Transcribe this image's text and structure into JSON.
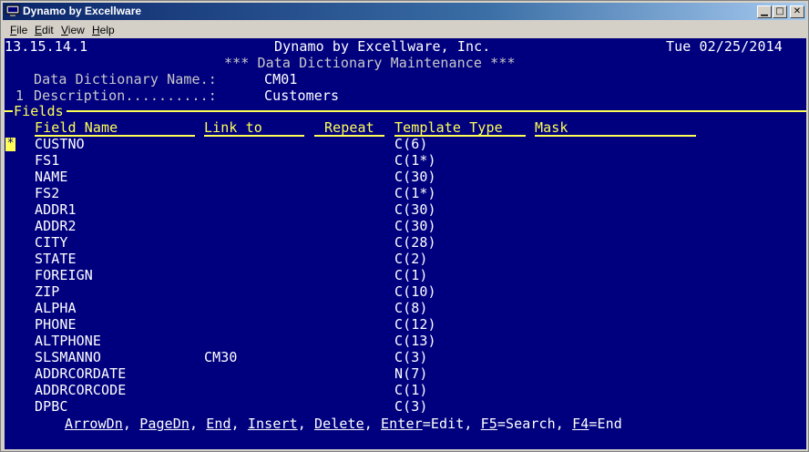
{
  "window": {
    "title": "Dynamo by Excellware"
  },
  "menu": [
    "File",
    "Edit",
    "View",
    "Help"
  ],
  "header": {
    "version": "13.15.14.1",
    "company": "Dynamo by Excellware, Inc.",
    "date": "Tue 02/25/2014",
    "screen_title": "*** Data Dictionary Maintenance ***",
    "dd_name_label": "Data Dictionary Name.:",
    "dd_name_value": "CM01",
    "desc_index": "1",
    "desc_label": "Description..........:",
    "desc_value": "Customers"
  },
  "section_label": "Fields",
  "columns": [
    "Field Name",
    "Link to",
    "Repeat",
    "Template Type",
    "Mask"
  ],
  "rows": [
    {
      "name": "CUSTNO",
      "link": "",
      "repeat": "",
      "template": "C(6)",
      "mask": ""
    },
    {
      "name": "FS1",
      "link": "",
      "repeat": "",
      "template": "C(1*)",
      "mask": ""
    },
    {
      "name": "NAME",
      "link": "",
      "repeat": "",
      "template": "C(30)",
      "mask": ""
    },
    {
      "name": "FS2",
      "link": "",
      "repeat": "",
      "template": "C(1*)",
      "mask": ""
    },
    {
      "name": "ADDR1",
      "link": "",
      "repeat": "",
      "template": "C(30)",
      "mask": ""
    },
    {
      "name": "ADDR2",
      "link": "",
      "repeat": "",
      "template": "C(30)",
      "mask": ""
    },
    {
      "name": "CITY",
      "link": "",
      "repeat": "",
      "template": "C(28)",
      "mask": ""
    },
    {
      "name": "STATE",
      "link": "",
      "repeat": "",
      "template": "C(2)",
      "mask": ""
    },
    {
      "name": "FOREIGN",
      "link": "",
      "repeat": "",
      "template": "C(1)",
      "mask": ""
    },
    {
      "name": "ZIP",
      "link": "",
      "repeat": "",
      "template": "C(10)",
      "mask": ""
    },
    {
      "name": "ALPHA",
      "link": "",
      "repeat": "",
      "template": "C(8)",
      "mask": ""
    },
    {
      "name": "PHONE",
      "link": "",
      "repeat": "",
      "template": "C(12)",
      "mask": ""
    },
    {
      "name": "ALTPHONE",
      "link": "",
      "repeat": "",
      "template": "C(13)",
      "mask": ""
    },
    {
      "name": "SLSMANNO",
      "link": "CM30",
      "repeat": "",
      "template": "C(3)",
      "mask": ""
    },
    {
      "name": "ADDRCORDATE",
      "link": "",
      "repeat": "",
      "template": "N(7)",
      "mask": ""
    },
    {
      "name": "ADDRCORCODE",
      "link": "",
      "repeat": "",
      "template": "C(1)",
      "mask": ""
    },
    {
      "name": "DPBC",
      "link": "",
      "repeat": "",
      "template": "C(3)",
      "mask": ""
    }
  ],
  "row_cursor": "*",
  "footer": {
    "keys": [
      {
        "key": "ArrowDn",
        "after": ", "
      },
      {
        "key": "PageDn",
        "after": ", "
      },
      {
        "key": "End",
        "after": ", "
      },
      {
        "key": "Insert",
        "after": ", "
      },
      {
        "key": "Delete",
        "after": ", "
      },
      {
        "key": "Enter",
        "after": "=Edit, "
      },
      {
        "key": "F5",
        "after": "=Search, "
      },
      {
        "key": "F4",
        "after": "=End"
      }
    ]
  },
  "colors": {
    "background": "#00007f",
    "highlight": "#ffff55",
    "text": "#ffffff"
  }
}
